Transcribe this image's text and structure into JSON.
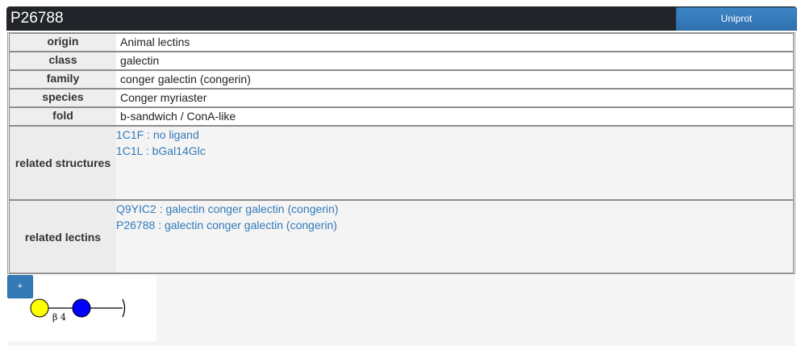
{
  "header": {
    "title": "P26788",
    "uniprot_label": "Uniprot"
  },
  "info": {
    "rows": [
      {
        "key": "origin",
        "value": "Animal lectins"
      },
      {
        "key": "class",
        "value": "galectin"
      },
      {
        "key": "family",
        "value": "conger galectin (congerin)"
      },
      {
        "key": "species",
        "value": "Conger myriaster"
      },
      {
        "key": "fold",
        "value": "b-sandwich / ConA-like"
      }
    ],
    "related_structures": {
      "key": "related structures",
      "links": [
        "1C1F : no ligand",
        "1C1L : bGal14Glc"
      ]
    },
    "related_lectins": {
      "key": "related lectins",
      "links": [
        "Q9YIC2 : galectin conger galectin (congerin)",
        "P26788 : galectin conger galectin (congerin)"
      ]
    }
  },
  "glycan": {
    "plus_label": "+",
    "linkage_label": "β 4",
    "colors": {
      "galactose": "#ffff00",
      "glucose": "#0000ff"
    }
  }
}
